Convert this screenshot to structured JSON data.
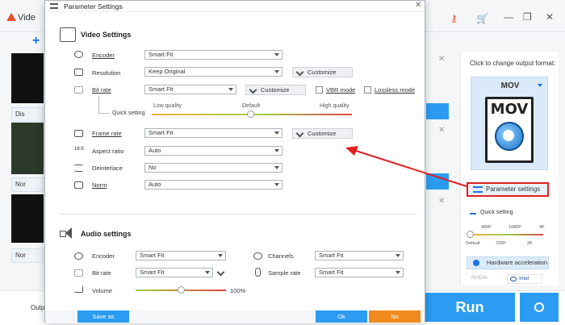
{
  "app": {
    "title": "Vide",
    "list_items": [
      "Dis",
      "Nor",
      "Nor"
    ],
    "footer_label": "Outp"
  },
  "sidebar": {
    "label": "Click to change output format:",
    "format": "MOV",
    "param_button": "Parameter settings",
    "quick_setting": "Quick setting",
    "ticks_top": [
      "480P",
      "1080P",
      "4K"
    ],
    "ticks_bottom": [
      "Default",
      "720P",
      "2K"
    ],
    "hw_accel": "Hardware acceleration",
    "nvidia": "NVIDIA",
    "intel": "Intel",
    "run": "Run"
  },
  "dialog": {
    "title": "Parameter Settings",
    "video": {
      "heading": "Video Settings",
      "encoder": {
        "label": "Encoder",
        "value": "Smart Fit"
      },
      "resolution": {
        "label": "Resolution",
        "value": "Keep Original",
        "customize": "Customize"
      },
      "bitrate": {
        "label": "Bit rate",
        "value": "Smart Fit",
        "customize": "Customize",
        "vbr": "VBR mode",
        "lossless": "Lossless mode"
      },
      "quick_setting": "Quick setting",
      "quality_low": "Low quality",
      "quality_default": "Default",
      "quality_high": "High quality",
      "framerate": {
        "label": "Frame rate",
        "value": "Smart Fit",
        "customize": "Customize"
      },
      "aspect": {
        "label": "Aspect ratio",
        "value": "Auto"
      },
      "deinterlace": {
        "label": "Deinterlace",
        "value": "No"
      },
      "norm": {
        "label": "Norm",
        "value": "Auto"
      }
    },
    "audio": {
      "heading": "Audio settings",
      "encoder": {
        "label": "Encoder",
        "value": "Smart Fit"
      },
      "channels": {
        "label": "Channels",
        "value": "Smart Fit"
      },
      "bitrate": {
        "label": "Bit rate",
        "value": "Smart Fit"
      },
      "samplerate": {
        "label": "Sample rate",
        "value": "Smart Fit"
      },
      "volume": {
        "label": "Volume",
        "value": "100%"
      }
    },
    "buttons": {
      "save_as": "Save as",
      "ok": "Ok",
      "no": "No"
    }
  },
  "colors": {
    "accent": "#2b9cf2",
    "arrow": "#e02020",
    "no_button": "#f08a1d"
  }
}
